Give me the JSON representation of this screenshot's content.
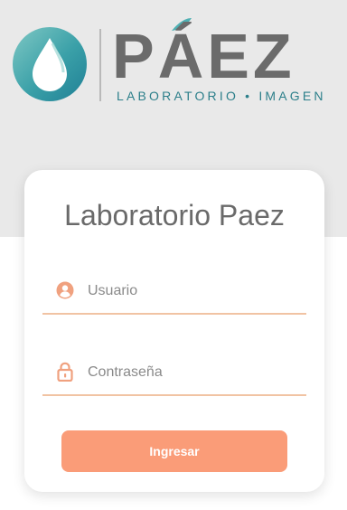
{
  "brand": {
    "name": "PÁEZ",
    "tagline": "LABORATORIO • IMAGEN",
    "logo_icon": "water-drop-icon"
  },
  "login": {
    "title": "Laboratorio Paez",
    "username": {
      "placeholder": "Usuario",
      "value": "",
      "icon": "user-icon"
    },
    "password": {
      "placeholder": "Contraseña",
      "value": "",
      "icon": "lock-icon"
    },
    "submit_label": "Ingresar"
  },
  "colors": {
    "background_band": "#e9e9e9",
    "brand_gray": "#6b6b6b",
    "brand_teal": "#2c7f8a",
    "accent_orange": "#fa9c78",
    "field_underline": "#f1c3a3"
  }
}
